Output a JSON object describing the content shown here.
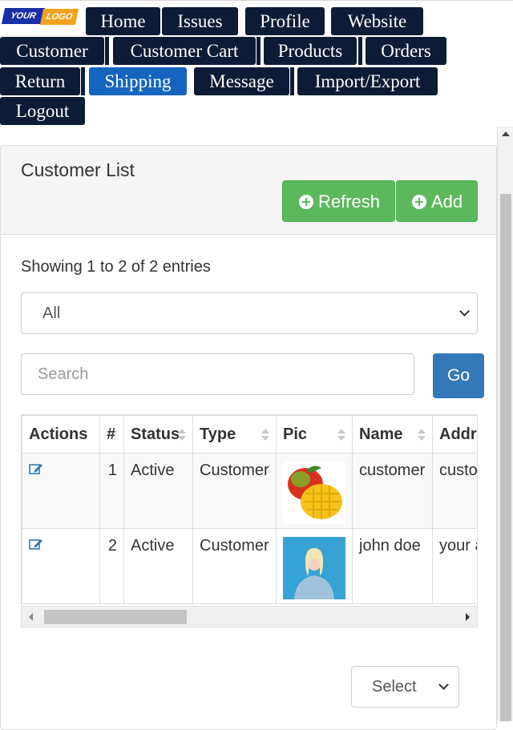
{
  "logo": {
    "part1": "YOUR",
    "part2": "LOGO"
  },
  "nav": {
    "items": [
      {
        "label": "Home"
      },
      {
        "label": "Issues"
      },
      {
        "label": "Profile"
      },
      {
        "label": "Website"
      },
      {
        "label": "Customer"
      },
      {
        "label": "Customer Cart"
      },
      {
        "label": "Products"
      },
      {
        "label": "Orders"
      },
      {
        "label": "Return"
      },
      {
        "label": "Shipping",
        "active": true
      },
      {
        "label": "Message"
      },
      {
        "label": "Import/Export"
      },
      {
        "label": "Logout"
      }
    ]
  },
  "panel": {
    "title": "Customer List",
    "refresh_label": "Refresh",
    "add_label": "Add"
  },
  "list": {
    "showing": "Showing 1 to 2 of 2 entries",
    "filter_value": "All",
    "search_placeholder": "Search",
    "go_label": "Go",
    "pager_value": "Select"
  },
  "table": {
    "headers": [
      "Actions",
      "#",
      "Status",
      "Type",
      "Pic",
      "Name",
      "Address"
    ],
    "rows": [
      {
        "num": "1",
        "status": "Active",
        "type": "Customer",
        "pic": "mango",
        "name": "customer",
        "address": "customer"
      },
      {
        "num": "2",
        "status": "Active",
        "type": "Customer",
        "pic": "person",
        "name": "john doe",
        "address": "your address"
      }
    ]
  },
  "colors": {
    "nav_bg": "#0d1c36",
    "nav_active": "#1565c0",
    "success": "#5cb85c",
    "primary": "#337ab7"
  },
  "icons": {
    "edit": "edit-icon",
    "plus": "plus-circle-icon",
    "dropdown": "chevron-down-icon"
  }
}
